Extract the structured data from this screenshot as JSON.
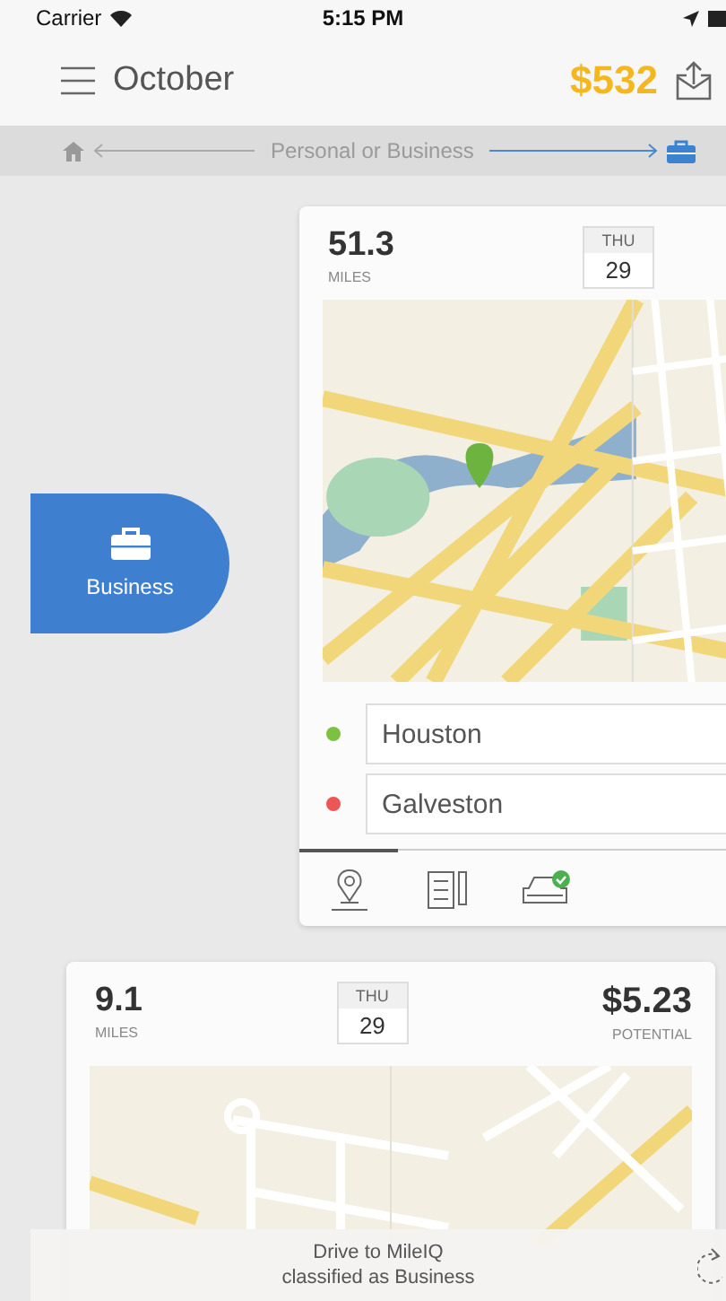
{
  "status_bar": {
    "carrier": "Carrier",
    "time": "5:15 PM"
  },
  "header": {
    "title": "October",
    "total": "$532"
  },
  "classify_banner": {
    "label": "Personal or Business"
  },
  "business_button": {
    "label": "Business"
  },
  "drives": [
    {
      "distance": "51.3",
      "unit": "MILES",
      "day": "THU",
      "date": "29",
      "start": "Houston",
      "end": "Galveston",
      "tabs": [
        {
          "kind": "route",
          "selected": true
        },
        {
          "kind": "notes",
          "selected": false
        },
        {
          "kind": "vehicle",
          "selected": false
        }
      ]
    },
    {
      "distance": "9.1",
      "unit": "MILES",
      "day": "THU",
      "date": "29",
      "value": "$5.23",
      "value_label": "POTENTIAL"
    }
  ],
  "toast": {
    "line_1": "Drive to MileIQ",
    "line_2": "classified as Business"
  }
}
